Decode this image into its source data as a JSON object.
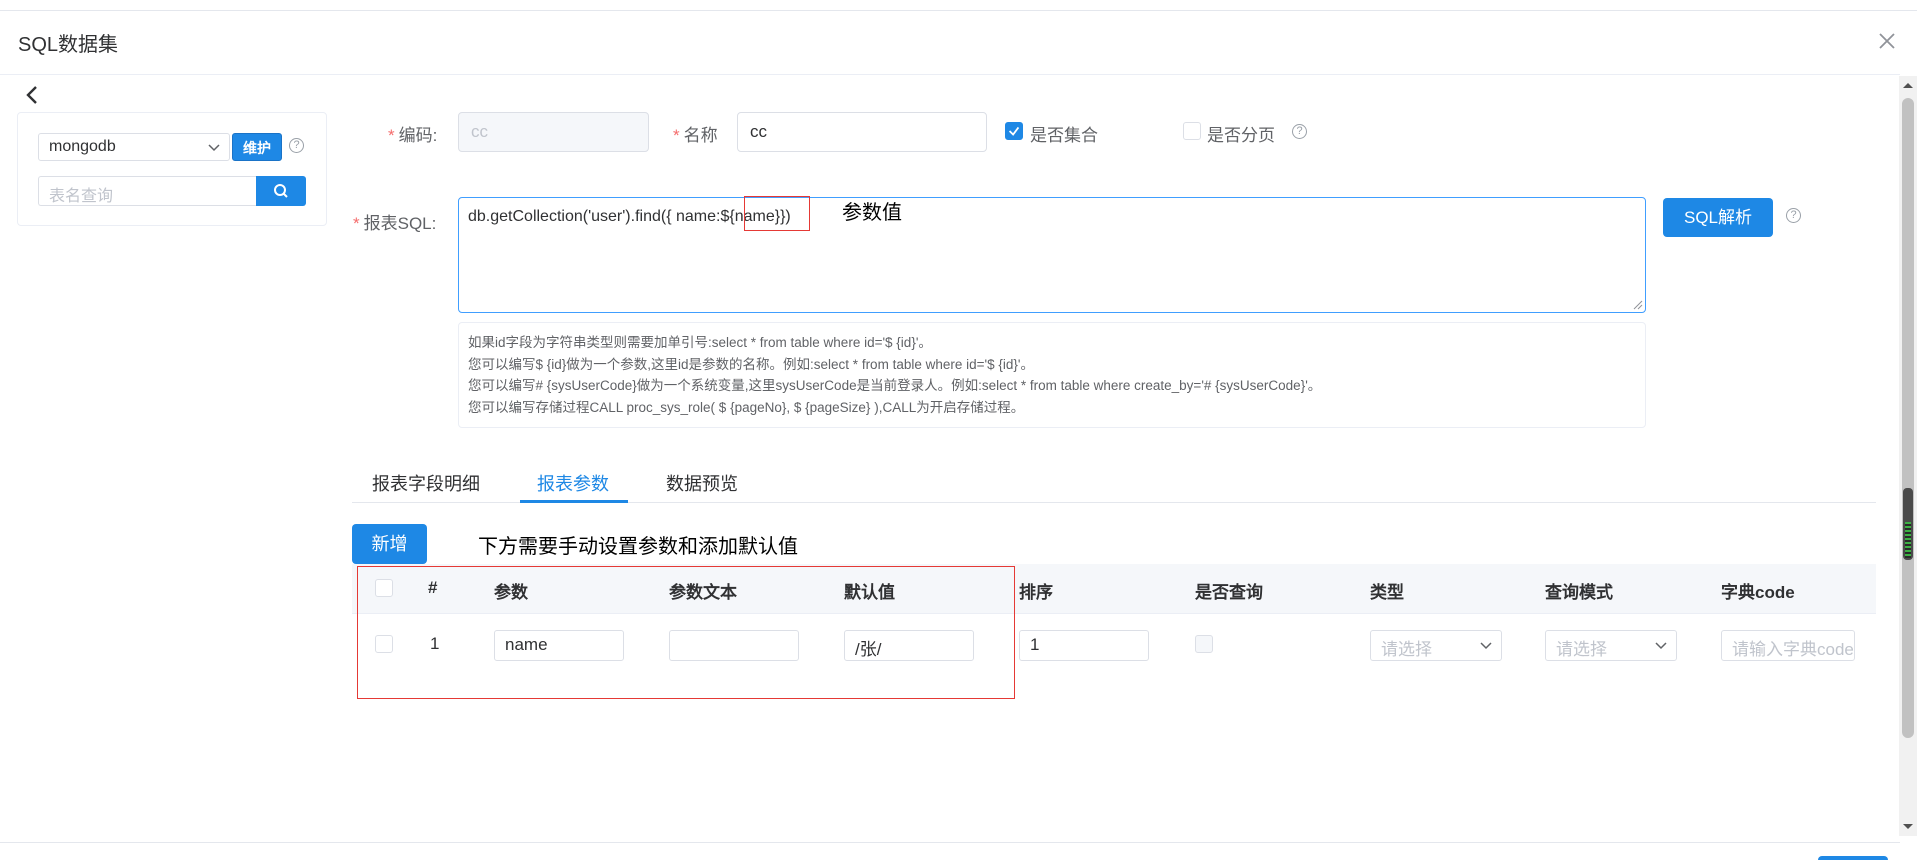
{
  "dialog": {
    "title": "SQL数据集"
  },
  "left_panel": {
    "datasource_value": "mongodb",
    "maintain_label": "维护",
    "help_mark": "?",
    "table_search_placeholder": "表名查询"
  },
  "form": {
    "code_label": "编码:",
    "code_value": "cc",
    "name_label": "名称",
    "name_value": "cc",
    "is_collection_label": "是否集合",
    "is_collection_checked": true,
    "is_paging_label": "是否分页",
    "is_paging_checked": false,
    "help_mark": "?",
    "sql_label": "报表SQL:",
    "sql_value": "db.getCollection('user').find({ name:${name}})",
    "sql_parse_label": "SQL解析",
    "hints": [
      "如果id字段为字符串类型则需要加单引号:select * from table where id='$ {id}'。",
      "您可以编写$ {id}做为一个参数,这里id是参数的名称。例如:select * from table where id='$ {id}'。",
      "您可以编写# {sysUserCode}做为一个系统变量,这里sysUserCode是当前登录人。例如:select * from table where create_by='# {sysUserCode}'。",
      "您可以编写存储过程CALL proc_sys_role( $ {pageNo}, $ {pageSize} ),CALL为开启存储过程。"
    ]
  },
  "annotations": {
    "param_value": "参数值",
    "manual_hint": "下方需要手动设置参数和添加默认值"
  },
  "tabs": [
    {
      "label": "报表字段明细",
      "active": false
    },
    {
      "label": "报表参数",
      "active": true
    },
    {
      "label": "数据预览",
      "active": false
    }
  ],
  "params_table": {
    "add_label": "新增",
    "columns": [
      "#",
      "参数",
      "参数文本",
      "默认值",
      "排序",
      "是否查询",
      "类型",
      "查询模式",
      "字典code"
    ],
    "rows": [
      {
        "index": "1",
        "param": "name",
        "param_text": "",
        "default_value": "/张/",
        "order": "1",
        "type_placeholder": "请选择",
        "mode_placeholder": "请选择",
        "dict_placeholder": "请输入字典code"
      }
    ]
  },
  "colors": {
    "primary": "#1e88e5",
    "annotation_box": "#e53935",
    "required": "#f56c6c"
  }
}
